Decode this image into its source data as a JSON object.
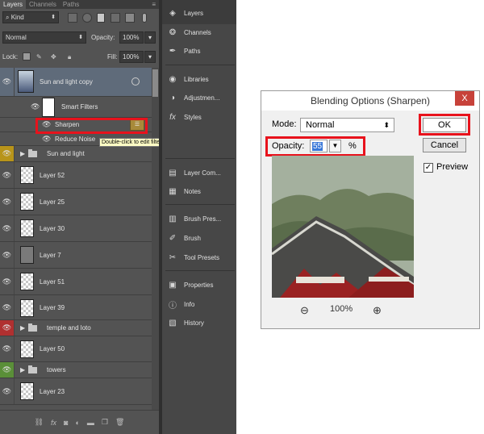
{
  "layers_panel": {
    "tabs": [
      "Layers",
      "Channels",
      "Paths"
    ],
    "menu_glyph": "≡",
    "filter_kind": "Kind",
    "blend_mode": "Normal",
    "opacity_label": "Opacity:",
    "opacity_value": "100%",
    "lock_label": "Lock:",
    "fill_label": "Fill:",
    "fill_value": "100%",
    "layers": [
      {
        "name": "Sun and light copy",
        "type": "smart-object"
      },
      {
        "name": "Smart Filters",
        "type": "smart-filters"
      },
      {
        "name": "Sharpen",
        "type": "filter"
      },
      {
        "name": "Reduce Noise",
        "type": "filter"
      },
      {
        "name": "Sun and light",
        "type": "group",
        "eye_color": "#c9a21a"
      },
      {
        "name": "Layer 52",
        "type": "layer"
      },
      {
        "name": "Layer 25",
        "type": "layer"
      },
      {
        "name": "Layer 30",
        "type": "layer"
      },
      {
        "name": "Layer 7",
        "type": "layer"
      },
      {
        "name": "Layer 51",
        "type": "layer"
      },
      {
        "name": "Layer 39",
        "type": "layer"
      },
      {
        "name": "temple and loto",
        "type": "group",
        "eye_color": "#b83030"
      },
      {
        "name": "Layer 50",
        "type": "layer"
      },
      {
        "name": "towers",
        "type": "group",
        "eye_color": "#5a9a3a"
      },
      {
        "name": "Layer 23",
        "type": "layer"
      }
    ],
    "tooltip": "Double-click to edit filter blending options",
    "bottom_icons": [
      "link-icon",
      "fx-icon",
      "mask-icon",
      "adjustment-icon",
      "folder-icon",
      "new-layer-icon",
      "trash-icon"
    ]
  },
  "dock": {
    "items": [
      "Layers",
      "Channels",
      "Paths",
      "Libraries",
      "Adjustmen...",
      "Styles",
      "Layer Com...",
      "Notes",
      "Brush Pres...",
      "Brush",
      "Tool Presets",
      "Properties",
      "Info",
      "History"
    ]
  },
  "dialog": {
    "title": "Blending Options (Sharpen)",
    "close_glyph": "X",
    "mode_label": "Mode:",
    "mode_value": "Normal",
    "opacity_label": "Opacity:",
    "opacity_value": "55",
    "percent": "%",
    "ok_label": "OK",
    "cancel_label": "Cancel",
    "preview_label": "Preview",
    "preview_checked": true,
    "zoom_value": "100%"
  },
  "colors": {
    "highlight": "#e8121c",
    "panel": "#535353",
    "dock": "#474747"
  }
}
